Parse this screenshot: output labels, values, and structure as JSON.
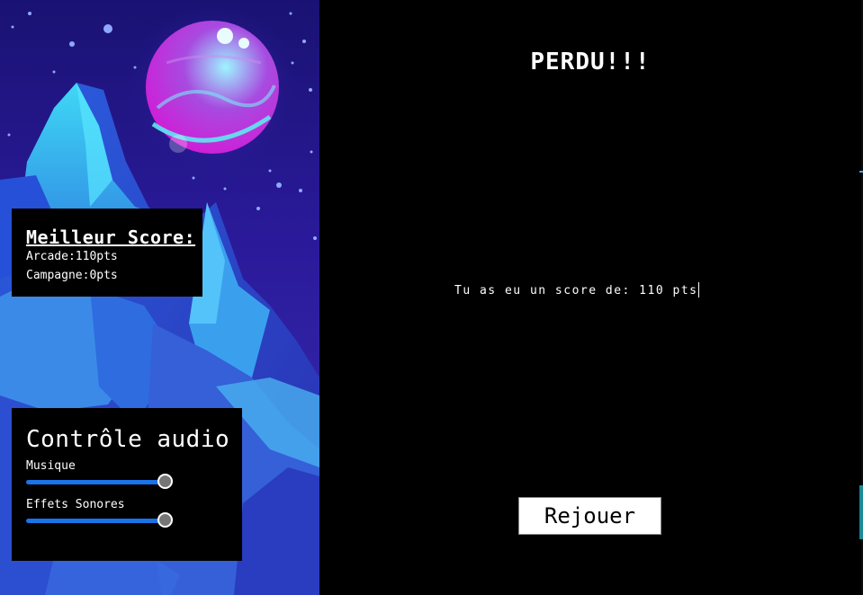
{
  "game": {
    "title": "PERDU!!!",
    "score_message": "Tu as eu un score de: 110 pts",
    "replay_label": "Rejouer"
  },
  "best_score": {
    "title": "Meilleur Score:",
    "arcade": "Arcade:110pts",
    "campagne": "Campagne:0pts"
  },
  "audio": {
    "title": "Contrôle audio",
    "music_label": "Musique",
    "music_level": 1.0,
    "sfx_label": "Effets Sonores",
    "sfx_level": 1.0
  },
  "colors": {
    "slider_track": "#1a73e8",
    "planet_magenta": "#d21bd6",
    "planet_cyan": "#5ee8f0",
    "mountain_light": "#35c8f0"
  },
  "icons": {
    "background": "space-mountain-planet-illustration"
  }
}
